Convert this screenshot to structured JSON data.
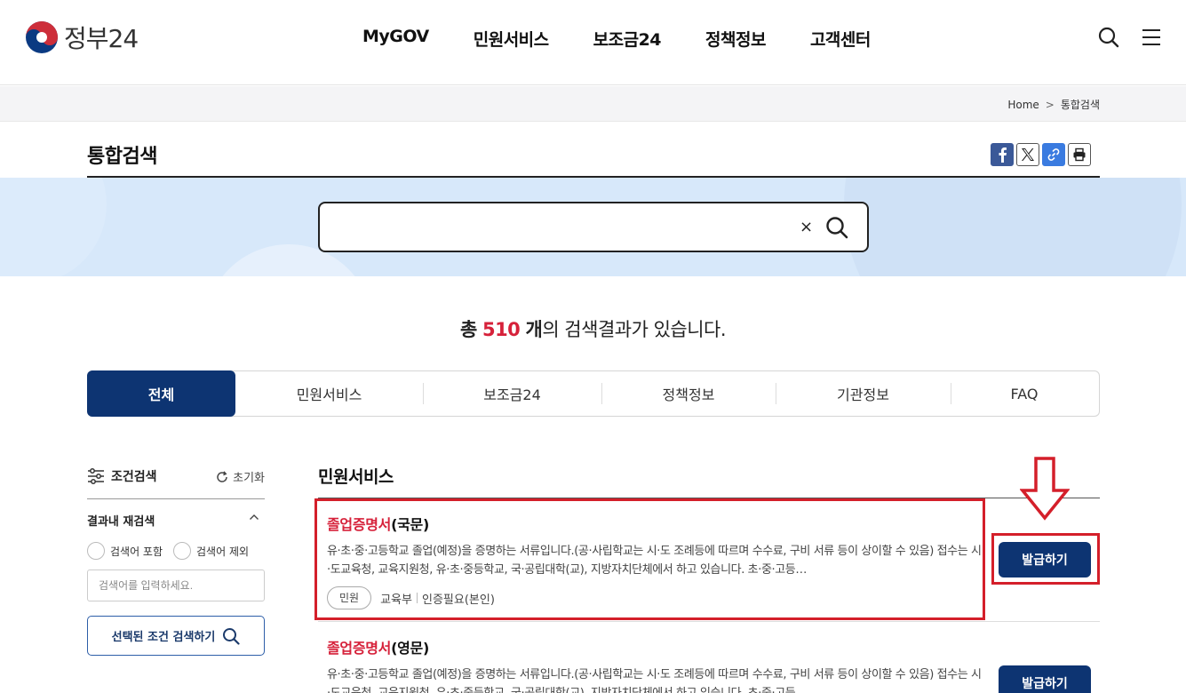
{
  "header": {
    "logo_text": "정부24",
    "nav": [
      "MyGOV",
      "민원서비스",
      "보조금24",
      "정책정보",
      "고객센터"
    ],
    "icons": [
      "search-icon",
      "menu-icon"
    ]
  },
  "breadcrumb": {
    "home": "Home",
    "separator": ">",
    "current": "통합검색"
  },
  "page": {
    "title": "통합검색",
    "share_icons": [
      "facebook-icon",
      "x-icon",
      "link-icon",
      "print-icon"
    ]
  },
  "search": {
    "value": "",
    "clear": "×"
  },
  "result_count": {
    "prefix": "총",
    "count": "510",
    "unit": "개",
    "suffix": "의 검색결과가 있습니다."
  },
  "tabs": [
    {
      "label": "전체",
      "active": true
    },
    {
      "label": "민원서비스",
      "active": false
    },
    {
      "label": "보조금24",
      "active": false
    },
    {
      "label": "정책정보",
      "active": false
    },
    {
      "label": "기관정보",
      "active": false
    },
    {
      "label": "FAQ",
      "active": false
    }
  ],
  "filter": {
    "title": "조건검색",
    "reset": "초기화",
    "refine_title": "결과내 재검색",
    "include": "검색어 포함",
    "exclude": "검색어 제외",
    "placeholder": "검색어를 입력하세요.",
    "submit": "선택된 조건 검색하기"
  },
  "section": {
    "title": "민원서비스"
  },
  "results": [
    {
      "title_highlight": "졸업증명서",
      "title_rest": "(국문)",
      "desc": "유·초·중·고등학교 졸업(예정)을 증명하는 서류입니다.(공·사립학교는 시·도 조례등에 따르며 수수료, 구비 서류 등이 상이할 수 있음) 접수는 시·도교육청, 교육지원청, 유·초·중등학교, 국·공립대학(교), 지방자치단체에서 하고 있습니다. 초·중·고등…",
      "badge": "민원",
      "agency": "교육부",
      "auth": "인증필요(본인)",
      "button": "발급하기"
    },
    {
      "title_highlight": "졸업증명서",
      "title_rest": "(영문)",
      "desc": "유·초·중·고등학교 졸업(예정)을 증명하는 서류입니다.(공·사립학교는 시·도 조례등에 따르며 수수료, 구비 서류 등이 상이할 수 있음) 접수는 시·도교육청, 교육지원청, 유·초·중등학교, 국·공립대학(교), 지방자치단체에서 하고 있습니다. 초·중·고등…",
      "button": "발급하기"
    }
  ],
  "colors": {
    "navy": "#0d3472",
    "highlight": "#d6213a",
    "annotation": "#d41f2a",
    "banner": "#d7e8fa"
  }
}
